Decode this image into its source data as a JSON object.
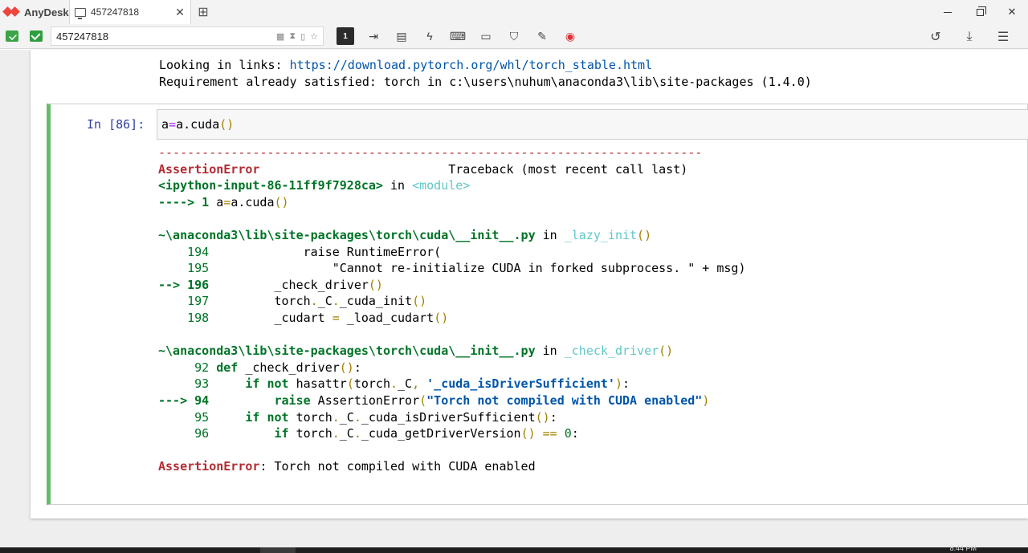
{
  "app": {
    "name": "AnyDesk",
    "tab_title": "457247818",
    "address": "457247818"
  },
  "toolbar": {
    "active_monitor": "1"
  },
  "notebook": {
    "prev_output": [
      "Looking in links: https://download.pytorch.org/whl/torch_stable.html",
      "Requirement already satisfied: torch in c:\\users\\nuhum\\anaconda3\\lib\\site-packages (1.4.0)"
    ],
    "cell": {
      "prompt": "In [86]:",
      "code": "a=a.cuda()"
    },
    "traceback": {
      "separator": "---------------------------------------------------------------------------",
      "error_name": "AssertionError",
      "header_right": "Traceback (most recent call last)",
      "input_ref": "<ipython-input-86-11ff9f7928ca>",
      "in_word": "in",
      "module": "<module>",
      "arrow1": "----> 1",
      "line1": "a=a.cuda()",
      "file1": "~\\anaconda3\\lib\\site-packages\\torch\\cuda\\__init__.py",
      "func1": "_lazy_init",
      "file2": "~\\anaconda3\\lib\\site-packages\\torch\\cuda\\__init__.py",
      "func2": "_check_driver",
      "final_name": "AssertionError",
      "final_msg": "Torch not compiled with CUDA enabled"
    }
  },
  "taskbar": {
    "clock": "8:44 PM"
  }
}
